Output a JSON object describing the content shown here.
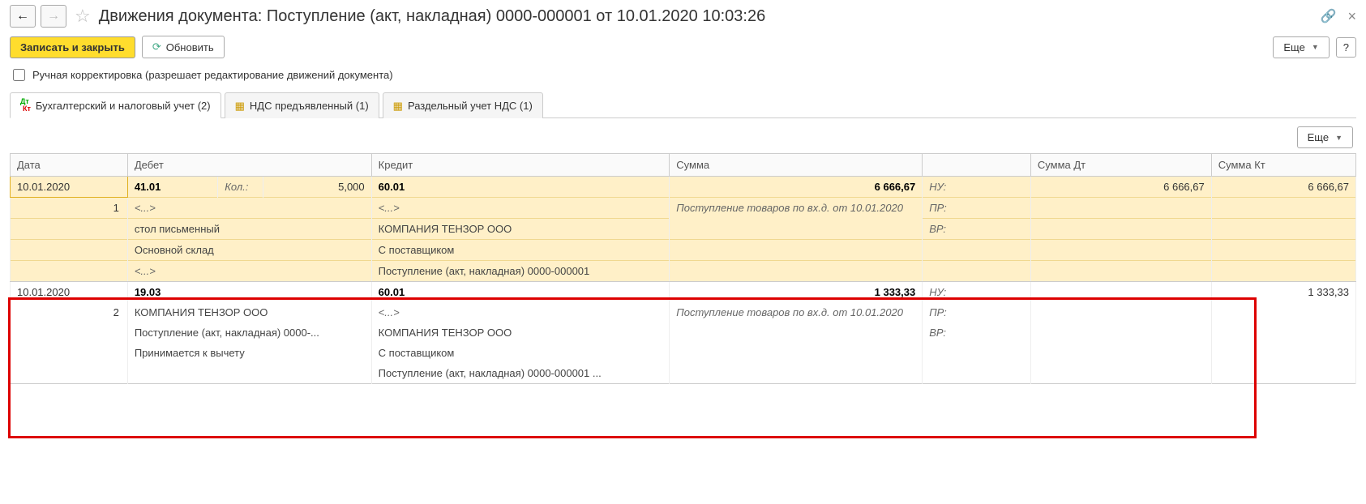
{
  "title": "Движения документа: Поступление (акт, накладная) 0000-000001 от 10.01.2020 10:03:26",
  "toolbar": {
    "save": "Записать и закрыть",
    "refresh": "Обновить",
    "more": "Еще"
  },
  "checkbox_label": "Ручная корректировка (разрешает редактирование движений документа)",
  "tabs": {
    "t1": "Бухгалтерский и налоговый учет (2)",
    "t2": "НДС предъявленный (1)",
    "t3": "Раздельный учет НДС (1)"
  },
  "cols": {
    "date": "Дата",
    "debit": "Дебет",
    "credit": "Кредит",
    "sum": "Сумма",
    "sum_dt": "Сумма Дт",
    "sum_kt": "Сумма Кт"
  },
  "r1": {
    "date": "10.01.2020",
    "seq": "1",
    "debit_acc": "41.01",
    "qty_lbl": "Кол.:",
    "qty": "5,000",
    "credit_acc": "60.01",
    "sum": "6 666,67",
    "nu": "НУ:",
    "nu_dt": "6 666,67",
    "nu_kt": "6 666,67",
    "pr": "ПР:",
    "vr": "ВР:",
    "desc": "Поступление товаров по вх.д.  от 10.01.2020",
    "d_angle": "<...>",
    "d_l1": "стол письменный",
    "d_l2": "Основной склад",
    "d_l3": "<...>",
    "c_angle": "<...>",
    "c_l1": "КОМПАНИЯ ТЕНЗОР ООО",
    "c_l2": "С поставщиком",
    "c_l3": "Поступление (акт, накладная) 0000-000001"
  },
  "r2": {
    "date": "10.01.2020",
    "seq": "2",
    "debit_acc": "19.03",
    "credit_acc": "60.01",
    "sum": "1 333,33",
    "nu": "НУ:",
    "nu_kt": "1 333,33",
    "pr": "ПР:",
    "vr": "ВР:",
    "desc": "Поступление товаров по вх.д.  от 10.01.2020",
    "d_l1": "КОМПАНИЯ ТЕНЗОР ООО",
    "d_l2": "Поступление (акт, накладная) 0000-...",
    "d_l3": "Принимается к вычету",
    "c_angle": "<...>",
    "c_l1": "КОМПАНИЯ ТЕНЗОР ООО",
    "c_l2": "С поставщиком",
    "c_l3": "Поступление (акт, накладная) 0000-000001 ..."
  }
}
